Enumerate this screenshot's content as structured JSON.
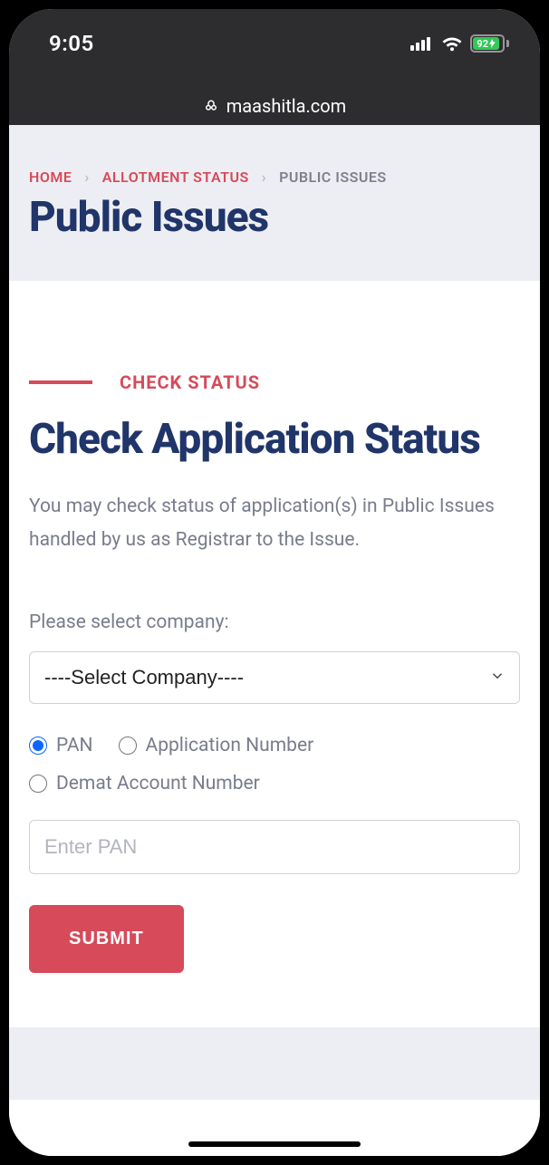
{
  "status_bar": {
    "time": "9:05",
    "battery_pct": "92"
  },
  "browser": {
    "host": "maashitla.com"
  },
  "breadcrumb": {
    "items": [
      {
        "label": "HOME"
      },
      {
        "label": "ALLOTMENT STATUS"
      }
    ],
    "current": "PUBLIC ISSUES"
  },
  "page": {
    "title": "Public Issues"
  },
  "section": {
    "eyebrow": "CHECK STATUS",
    "heading": "Check Application Status",
    "description": "You may check status of application(s) in Public Issues handled by us as Registrar to the Issue."
  },
  "form": {
    "company_label": "Please select company:",
    "company_selected": "----Select Company----",
    "radios": {
      "pan": "PAN",
      "app_no": "Application Number",
      "demat": "Demat Account Number",
      "selected": "pan"
    },
    "input_placeholder": "Enter PAN",
    "input_value": "",
    "submit": "SUBMIT"
  }
}
